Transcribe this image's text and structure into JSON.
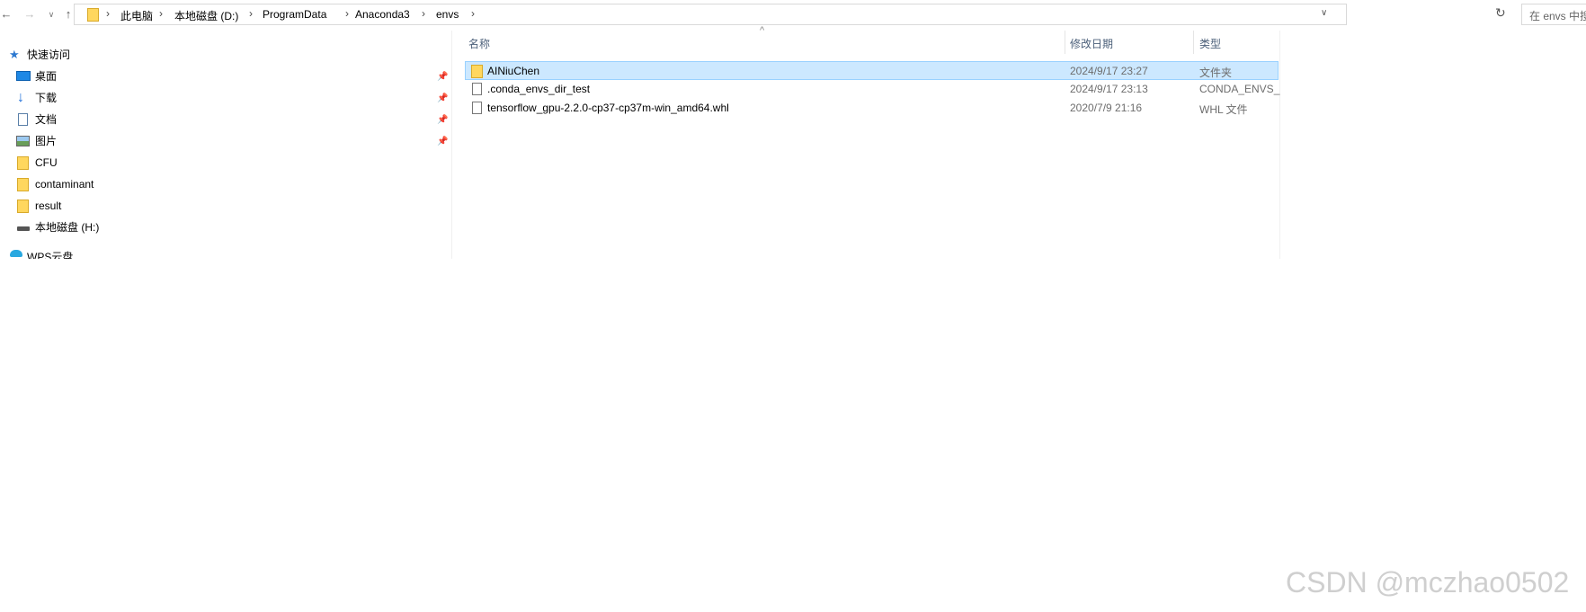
{
  "toolbar": {
    "back": "←",
    "forward": "→",
    "recent": "∨",
    "up": "↑",
    "refresh": "↻",
    "dropdown": "∨"
  },
  "breadcrumb": [
    "此电脑",
    "本地磁盘 (D:)",
    "ProgramData",
    "Anaconda3",
    "envs"
  ],
  "search": {
    "placeholder": "在 envs 中搜"
  },
  "sidebar": {
    "items": [
      {
        "label": "快速访问",
        "icon": "star-icon"
      },
      {
        "label": "桌面",
        "icon": "desktop-icon",
        "pinned": true
      },
      {
        "label": "下载",
        "icon": "download-icon",
        "pinned": true
      },
      {
        "label": "文档",
        "icon": "document-icon",
        "pinned": true
      },
      {
        "label": "图片",
        "icon": "picture-icon",
        "pinned": true
      },
      {
        "label": "CFU",
        "icon": "folder-icon"
      },
      {
        "label": "contaminant",
        "icon": "folder-icon"
      },
      {
        "label": "result",
        "icon": "folder-icon"
      },
      {
        "label": "本地磁盘 (H:)",
        "icon": "drive-icon"
      },
      {
        "label": "WPS云盘",
        "icon": "cloud-icon"
      }
    ]
  },
  "columns": {
    "name": "名称",
    "modified": "修改日期",
    "type": "类型",
    "sort_indicator": "^"
  },
  "files": [
    {
      "name": "AINiuChen",
      "modified": "2024/9/17 23:27",
      "type": "文件夹",
      "icon": "folder-icon",
      "selected": true
    },
    {
      "name": ".conda_envs_dir_test",
      "modified": "2024/9/17 23:13",
      "type": "CONDA_ENVS_",
      "icon": "file-icon",
      "selected": false
    },
    {
      "name": "tensorflow_gpu-2.2.0-cp37-cp37m-win_amd64.whl",
      "modified": "2020/7/9 21:16",
      "type": "WHL 文件",
      "icon": "file-icon",
      "selected": false
    }
  ],
  "watermark": "CSDN @mczhao0502",
  "colors": {
    "selection": "#cce8ff",
    "selection_border": "#99d1ff",
    "header_text": "#4c607a",
    "folder": "#ffd75e"
  }
}
